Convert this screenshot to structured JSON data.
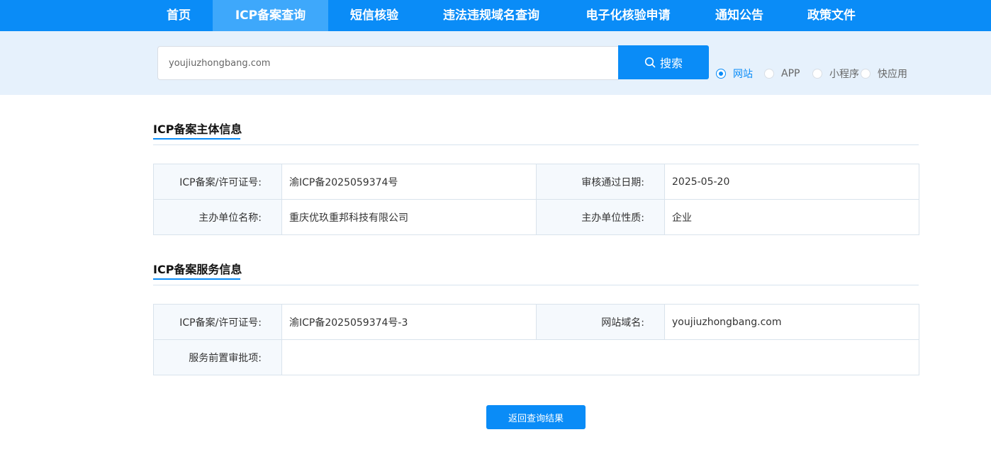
{
  "nav": {
    "items": [
      {
        "label": "首页"
      },
      {
        "label": "ICP备案查询"
      },
      {
        "label": "短信核验"
      },
      {
        "label": "违法违规域名查询"
      },
      {
        "label": "电子化核验申请"
      },
      {
        "label": "通知公告"
      },
      {
        "label": "政策文件"
      }
    ],
    "active": "ICP备案查询"
  },
  "search": {
    "value": "youjiuzhongbang.com",
    "button_label": "搜索",
    "types": [
      {
        "label": "网站",
        "checked": true
      },
      {
        "label": "APP",
        "checked": false
      },
      {
        "label": "小程序",
        "checked": false
      },
      {
        "label": "快应用",
        "checked": false
      }
    ]
  },
  "subject": {
    "title": "ICP备案主体信息",
    "license_label": "ICP备案/许可证号:",
    "license_value": "渝ICP备2025059374号",
    "date_label": "审核通过日期:",
    "date_value": "2025-05-20",
    "org_name_label": "主办单位名称:",
    "org_name_value": "重庆优玖重邦科技有限公司",
    "org_type_label": "主办单位性质:",
    "org_type_value": "企业"
  },
  "service": {
    "title": "ICP备案服务信息",
    "license_label": "ICP备案/许可证号:",
    "license_value": "渝ICP备2025059374号-3",
    "domain_label": "网站域名:",
    "domain_value": "youjiuzhongbang.com",
    "approval_label": "服务前置审批项:",
    "approval_value": ""
  },
  "back_button": {
    "label": "返回查询结果"
  },
  "colors": {
    "primary": "#0a8cf7",
    "nav_active": "#3ea8fb",
    "search_band": "#e6f1fc",
    "label_bg": "#f5f9fd"
  }
}
